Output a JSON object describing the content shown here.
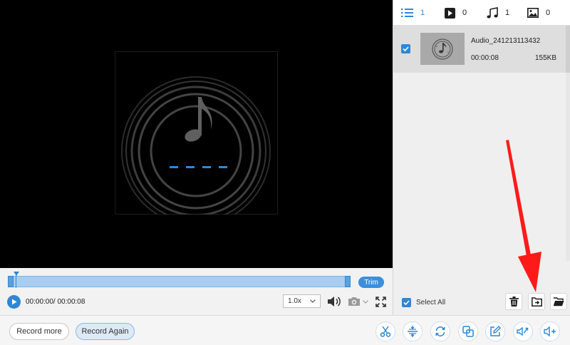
{
  "filter_tabs": [
    {
      "icon": "list-icon",
      "count": "1",
      "active": true
    },
    {
      "icon": "video-icon",
      "count": "0",
      "active": false
    },
    {
      "icon": "music-icon",
      "count": "1",
      "active": false
    },
    {
      "icon": "image-icon",
      "count": "0",
      "active": false
    }
  ],
  "file_list": {
    "items": [
      {
        "name": "Audio_241213113432",
        "duration": "00:00:08",
        "size": "155KB",
        "checked": true
      }
    ]
  },
  "select_all_label": "Select All",
  "timeline": {
    "trim_label": "Trim",
    "time_display": "00:00:00/ 00:00:08",
    "speed": "1.0x"
  },
  "bottom": {
    "record_more_label": "Record more",
    "record_again_label": "Record Again",
    "tools": [
      "scissors-icon",
      "merge-icon",
      "convert-icon",
      "compress-icon",
      "edit-icon",
      "export-icon",
      "volume-boost-icon"
    ]
  },
  "colors": {
    "accent": "#2f87d6",
    "annotation": "#ff0000",
    "preview_bg": "#000000"
  }
}
